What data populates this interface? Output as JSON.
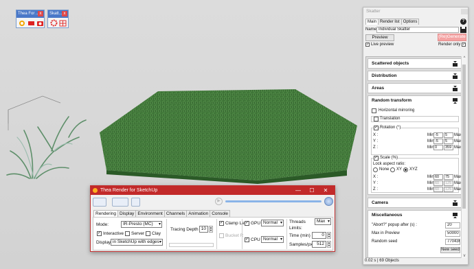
{
  "toolbars": {
    "thea": {
      "title": "Thea For ...",
      "close": "x"
    },
    "skatter": {
      "title": "Skatt...",
      "close": "x"
    }
  },
  "thea_window": {
    "title": "Thea Render for SketchUp",
    "controls": {
      "minimize": "—",
      "maximize": "☐",
      "close": "✕"
    },
    "tabs": [
      "Rendering",
      "Display",
      "Environment",
      "Channels",
      "Animation",
      "Console"
    ],
    "active_tab": "Rendering",
    "mode_label": "Mode:",
    "mode_value": "IR-Presto (MC)",
    "interactive_label": "Interactive",
    "interactive_checked": true,
    "server_label": "Server",
    "clay_label": "Clay",
    "display_label": "Display",
    "display_value": "in SketchUp with edges",
    "tracing_depth_label": "Tracing Depth",
    "tracing_depth_value": "10",
    "clamp_label": "Clamp Le",
    "clamp_checked": true,
    "bucket_label": "Bucket R",
    "gpu_label": "GPU",
    "gpu_checked": true,
    "gpu_value": "Normal",
    "cpu_label": "CPU",
    "cpu_checked": true,
    "cpu_value": "Normal",
    "threads_label": "Threads",
    "threads_value": "Max",
    "limits_label": "Limits:",
    "time_label": "Time (min)",
    "time_value": "0",
    "samples_label": "Samples/px",
    "samples_value": "512"
  },
  "skatter_panel": {
    "title": "Skatter",
    "help": "?",
    "tabs": [
      "Main",
      "Render list",
      "Options"
    ],
    "active_tab": "Main",
    "name_label": "Name",
    "name_value": "Individual Skatter",
    "preview_button": "Preview",
    "regenerate_button": "(Re)Generate",
    "live_preview_label": "Live preview",
    "render_only_label": "Render only",
    "sections": {
      "scattered_objects": "Scattered objects",
      "distribution": "Distribution",
      "areas": "Areas",
      "random_transform": "Random transform",
      "camera": "Camera",
      "miscellaneous": "Miscellaneous"
    },
    "random_transform": {
      "horizontal_mirroring": "Horizontal mirroring",
      "translation": "Translation",
      "rotation": "Rotation (°)",
      "rotation_rows": [
        {
          "axis": "X :",
          "min": "-5",
          "max": "5"
        },
        {
          "axis": "Y :",
          "min": "-5",
          "max": "5"
        },
        {
          "axis": "Z :",
          "min": "0",
          "max": "359"
        }
      ],
      "scale": "Scale (%)",
      "lock_aspect": "Lock aspect ratio:",
      "lock_options": [
        "None",
        "XY",
        "XYZ"
      ],
      "lock_selected": "XYZ",
      "scale_rows": [
        {
          "axis": "X :",
          "min": "60",
          "max": "75"
        },
        {
          "axis": "Y :",
          "min": "60",
          "max": "125"
        },
        {
          "axis": "Z :",
          "min": "60",
          "max": "125"
        }
      ],
      "min_label": "Min",
      "max_label": "Max"
    },
    "miscellaneous": {
      "abort_label": "\"Abort?\" popup after (s) :",
      "abort_value": "20",
      "max_preview_label": "Max in Preview",
      "max_preview_value": "50000",
      "random_seed_label": "Random seed",
      "random_seed_value": "770436",
      "new_seed_button": "New seed"
    },
    "status": "0.02 s | 69 Objects"
  },
  "colors": {
    "thea_red": "#c22a2a",
    "grass": "#3f7a3a",
    "regenerate_pink": "#f4a3a3",
    "toolbar_blue": "#4a78c8"
  }
}
